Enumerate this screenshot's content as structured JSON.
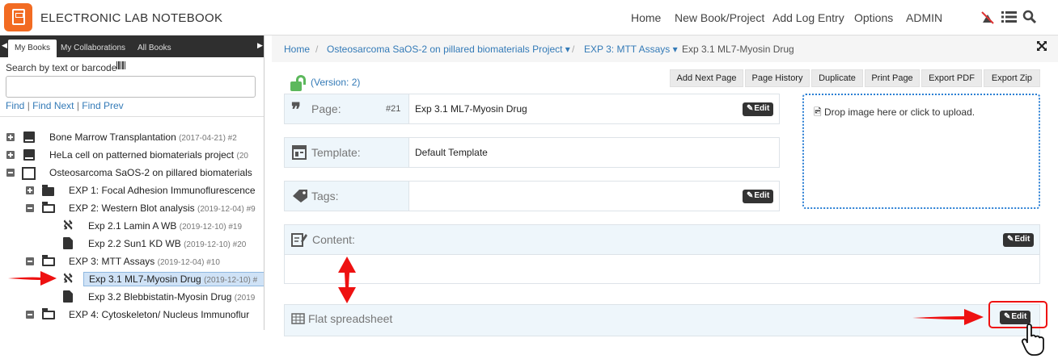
{
  "app": {
    "title": "ELECTRONIC LAB NOTEBOOK"
  },
  "topnav": {
    "items": [
      "Home",
      "New Book/Project",
      "Add Log Entry",
      "Options",
      "ADMIN"
    ],
    "icons": [
      "fire-off-icon",
      "list-icon",
      "search-icon"
    ]
  },
  "sidebar": {
    "tabs": [
      "My Books",
      "My Collaborations",
      "All Books"
    ],
    "active_tab": "My Books",
    "search_label": "Search by text or barcode",
    "search_value": "",
    "find_links": [
      "Find",
      "Find Next",
      "Find Prev"
    ],
    "tree": [
      {
        "title": "Bone Marrow Transplantation",
        "meta": "(2017-04-21) #2"
      },
      {
        "title": "HeLa cell on patterned biomaterials project",
        "meta": "(20"
      },
      {
        "title": "Osteosarcoma SaOS-2 on pillared biomaterials",
        "meta": ""
      },
      {
        "title": "EXP 1: Focal Adhesion Immunoflurescence",
        "meta": ""
      },
      {
        "title": "EXP 2: Western Blot analysis",
        "meta": "(2019-12-04) #9"
      },
      {
        "title": "Exp 2.1 Lamin A WB",
        "meta": "(2019-12-10) #19"
      },
      {
        "title": "Exp 2.2 Sun1 KD WB",
        "meta": "(2019-12-10) #20"
      },
      {
        "title": "EXP 3: MTT Assays",
        "meta": "(2019-12-04) #10"
      },
      {
        "title": "Exp 3.1 ML7-Myosin Drug",
        "meta": "(2019-12-10) #"
      },
      {
        "title": "Exp 3.2 Blebbistatin-Myosin Drug",
        "meta": "(2019"
      },
      {
        "title": "EXP 4: Cytoskeleton/ Nucleus Immunoflur",
        "meta": ""
      }
    ]
  },
  "breadcrumb": {
    "home": "Home",
    "project": "Osteosarcoma SaOS-2 on pillared biomaterials Project",
    "experiment": "EXP 3: MTT Assays",
    "current": "Exp 3.1 ML7-Myosin Drug"
  },
  "toolbar": {
    "buttons": [
      "Add Next Page",
      "Page History",
      "Duplicate",
      "Print Page",
      "Export PDF",
      "Export Zip"
    ]
  },
  "version": "(Version: 2)",
  "fields": {
    "page": {
      "label": "Page:",
      "number": "#21",
      "value": "Exp 3.1 ML7-Myosin Drug"
    },
    "template": {
      "label": "Template:",
      "value": "Default Template"
    },
    "tags": {
      "label": "Tags:",
      "value": ""
    }
  },
  "sections": {
    "content": "Content:",
    "spreadsheet": "Flat spreadsheet"
  },
  "edit_label": "Edit",
  "dropzone": {
    "text": "Drop image here or click to upload."
  },
  "colors": {
    "brand": "#f26b22",
    "link": "#337ab7",
    "annotation": "#e11111",
    "dropzone_border": "#2a7fd4"
  }
}
